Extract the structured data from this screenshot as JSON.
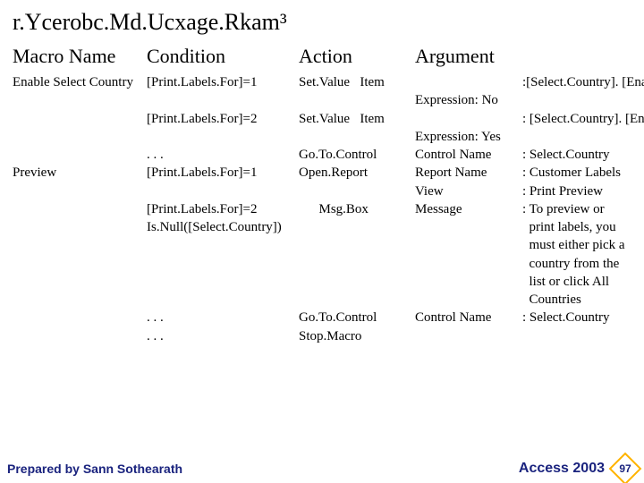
{
  "title": "r.Ycerobc.Md.Ucxage.Rkam³",
  "headers": {
    "macro": "Macro Name",
    "condition": "Condition",
    "action": "Action",
    "argument": "Argument"
  },
  "rows": [
    {
      "macro": "Enable Select Country",
      "condition": "[Print.Labels.For]=1",
      "action": "Set.Value   Item",
      "arg_label": "",
      "arg_value": ":[Select.Country]. [Enabled]"
    },
    {
      "macro": "",
      "condition": "",
      "action": "",
      "arg_label": "Expression: No",
      "arg_value": ""
    },
    {
      "macro": "",
      "condition": "[Print.Labels.For]=2",
      "action": "Set.Value   Item",
      "arg_label": "",
      "arg_value": ": [Select.Country]. [Enabled]"
    },
    {
      "macro": "",
      "condition": "",
      "action": "",
      "arg_label": "Expression: Yes",
      "arg_value": ""
    },
    {
      "macro": "",
      "condition": ". . .",
      "action": "Go.To.Control",
      "arg_label": "Control Name",
      "arg_value": ": Select.Country"
    },
    {
      "macro": "Preview",
      "condition": "[Print.Labels.For]=1",
      "action": "Open.Report",
      "arg_label": "Report Name",
      "arg_value": ": Customer Labels"
    },
    {
      "macro": "",
      "condition": "",
      "action": "",
      "arg_label": "View",
      "arg_value": ": Print Preview"
    },
    {
      "macro": "",
      "condition": "",
      "action": "",
      "arg_label": "",
      "arg_value": ""
    },
    {
      "macro": "",
      "condition": "[Print.Labels.For]=2",
      "action": "      Msg.Box",
      "arg_label": "Message",
      "arg_value": ": To preview or"
    },
    {
      "macro": "",
      "condition": "",
      "action": "",
      "arg_label": "",
      "arg_value": ""
    },
    {
      "macro": "",
      "condition": "Is.Null([Select.Country])",
      "action": "",
      "arg_label": "",
      "arg_value": "  print labels, you"
    },
    {
      "macro": "",
      "condition": "",
      "action": "",
      "arg_label": "",
      "arg_value": "  must either pick a"
    },
    {
      "macro": "",
      "condition": "",
      "action": "",
      "arg_label": "",
      "arg_value": "  country from the"
    },
    {
      "macro": "",
      "condition": "",
      "action": "",
      "arg_label": "",
      "arg_value": "  list or click All"
    },
    {
      "macro": "",
      "condition": "",
      "action": "",
      "arg_label": "",
      "arg_value": "  Countries"
    },
    {
      "macro": "",
      "condition": "  . . .",
      "action": "Go.To.Control",
      "arg_label": "Control Name",
      "arg_value": ": Select.Country"
    },
    {
      "macro": "",
      "condition": "  . . .",
      "action": "Stop.Macro",
      "arg_label": "",
      "arg_value": ""
    }
  ],
  "footer": {
    "prepared": "Prepared by Sann Sothearath",
    "brand": "Access 2003",
    "page": "97"
  }
}
